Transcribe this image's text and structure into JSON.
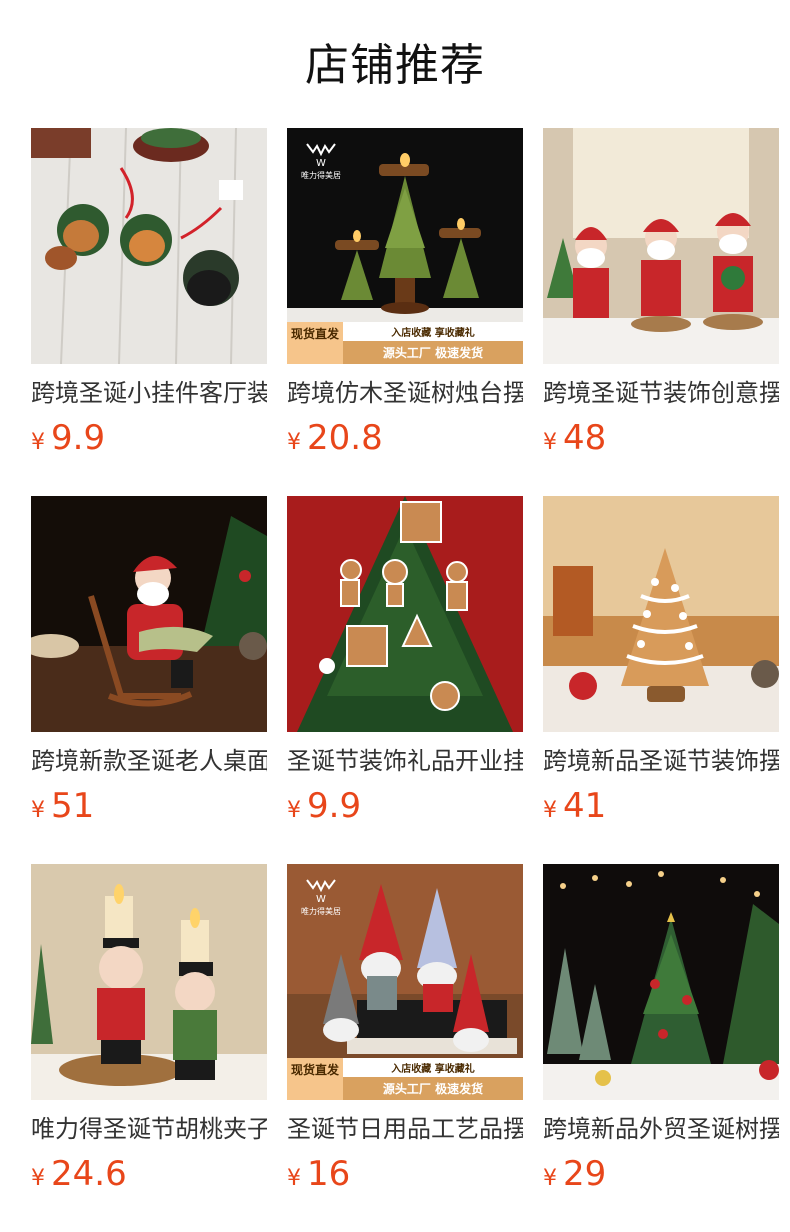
{
  "section": {
    "title": "店铺推荐"
  },
  "currency_symbol": "¥",
  "products": [
    {
      "name": "跨境圣诞小挂件客厅装饰",
      "price": "9.9",
      "image": "resin-ornaments-on-white-wood"
    },
    {
      "name": "跨境仿木圣诞树烛台摆件",
      "price": "20.8",
      "image": "tree-candle-holders-black",
      "logo_text": "唯力得美居",
      "badge": {
        "left": "现货直发",
        "top": "入店收藏 享收藏礼",
        "bottom": "源头工厂 极速发货"
      }
    },
    {
      "name": "跨境圣诞节装饰创意摆件",
      "price": "48",
      "image": "santa-figurines-window"
    },
    {
      "name": "跨境新款圣诞老人桌面摆件",
      "price": "51",
      "image": "santa-rocking-chair"
    },
    {
      "name": "圣诞节装饰礼品开业挂件",
      "price": "9.9",
      "image": "gingerbread-ornaments-tree"
    },
    {
      "name": "跨境新品圣诞节装饰摆件",
      "price": "41",
      "image": "gingerbread-tree-figurine"
    },
    {
      "name": "唯力得圣诞节胡桃夹子烛台",
      "price": "24.6",
      "image": "nutcracker-candle-holders"
    },
    {
      "name": "圣诞节日用品工艺品摆件",
      "price": "16",
      "image": "gnome-ornaments",
      "logo_text": "唯力得美居",
      "badge": {
        "left": "现货直发",
        "top": "入店收藏 享收藏礼",
        "bottom": "源头工厂 极速发货"
      }
    },
    {
      "name": "跨境新品外贸圣诞树摆件",
      "price": "29",
      "image": "resin-christmas-tree"
    }
  ],
  "colors": {
    "price": "#e8461a",
    "text": "#333333",
    "title": "#111111"
  }
}
